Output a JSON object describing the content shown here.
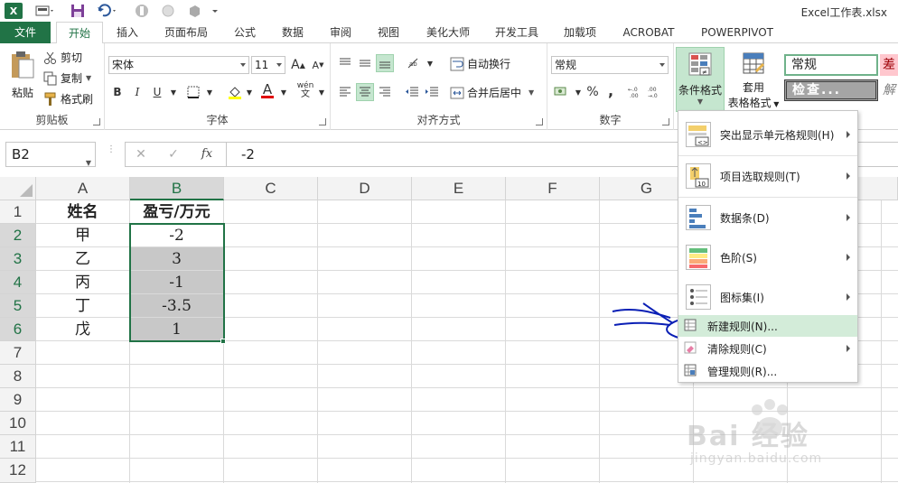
{
  "titlebar": {
    "filename": "Excel工作表.xlsx",
    "logo_letter": "X"
  },
  "tabs": [
    {
      "label": "文件"
    },
    {
      "label": "开始"
    },
    {
      "label": "插入"
    },
    {
      "label": "页面布局"
    },
    {
      "label": "公式"
    },
    {
      "label": "数据"
    },
    {
      "label": "审阅"
    },
    {
      "label": "视图"
    },
    {
      "label": "美化大师"
    },
    {
      "label": "开发工具"
    },
    {
      "label": "加载项"
    },
    {
      "label": "ACROBAT"
    },
    {
      "label": "POWERPIVOT"
    }
  ],
  "ribbon": {
    "clipboard": {
      "label": "剪贴板",
      "paste": "粘贴",
      "cut": "剪切",
      "copy": "复制",
      "format_painter": "格式刷"
    },
    "font": {
      "label": "字体",
      "font_name": "宋体",
      "font_size": "11",
      "bold": "B",
      "italic": "I",
      "underline": "U",
      "grow": "A",
      "shrink": "A",
      "color_a": "A",
      "phonetic": "wén"
    },
    "alignment": {
      "label": "对齐方式",
      "wrap_text": "自动换行",
      "merge_center": "合并后居中"
    },
    "number": {
      "label": "数字",
      "format": "常规",
      "percent": "%",
      "comma": ","
    },
    "styles": {
      "conditional_format": "条件格式",
      "table_format_l1": "套用",
      "table_format_l2": "表格格式",
      "style_normal": "常规",
      "style_check": "检查...",
      "style_bad": "差"
    }
  },
  "formula_bar": {
    "name_box": "B2",
    "cancel": "✕",
    "enter": "✓",
    "fx": "fx",
    "value": "-2"
  },
  "grid": {
    "columns": [
      "A",
      "B",
      "C",
      "D",
      "E",
      "F",
      "G"
    ],
    "rows": [
      "1",
      "2",
      "3",
      "4",
      "5",
      "6",
      "7",
      "8",
      "9",
      "10",
      "11",
      "12"
    ],
    "header": {
      "a": "姓名",
      "b": "盈亏/万元"
    },
    "data": [
      {
        "name": "甲",
        "value": "-2"
      },
      {
        "name": "乙",
        "value": "3"
      },
      {
        "name": "丙",
        "value": "-1"
      },
      {
        "name": "丁",
        "value": "-3.5"
      },
      {
        "name": "戊",
        "value": "1"
      }
    ]
  },
  "cf_menu": {
    "items": [
      {
        "label": "突出显示单元格规则(H)"
      },
      {
        "label": "项目选取规则(T)"
      },
      {
        "label": "数据条(D)"
      },
      {
        "label": "色阶(S)"
      },
      {
        "label": "图标集(I)"
      },
      {
        "label": "新建规则(N)..."
      },
      {
        "label": "清除规则(C)"
      },
      {
        "label": "管理规则(R)..."
      }
    ],
    "icon_top10": "10"
  },
  "watermark": {
    "text": "Bai 经验",
    "url": "jingyan.baidu.com"
  },
  "colors": {
    "excel_green": "#217346",
    "highlight": "#d3ecd9",
    "annotation_blue": "#0a1fb5"
  }
}
